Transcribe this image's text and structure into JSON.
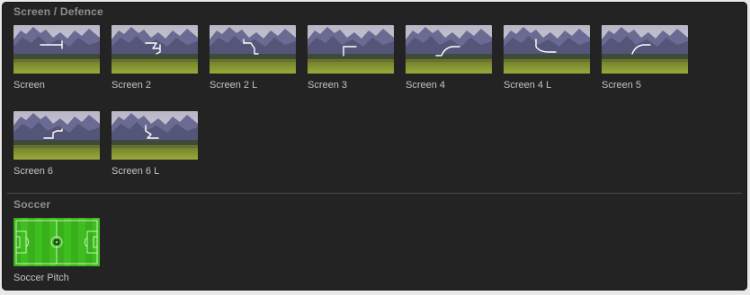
{
  "sections": [
    {
      "title": "Screen / Defence",
      "items": [
        {
          "label": "Screen",
          "icon": "screen-wipe-icon"
        },
        {
          "label": "Screen 2",
          "icon": "screen-2-wipe-icon"
        },
        {
          "label": "Screen 2 L",
          "icon": "screen-2-l-wipe-icon"
        },
        {
          "label": "Screen 3",
          "icon": "screen-3-wipe-icon"
        },
        {
          "label": "Screen 4",
          "icon": "screen-4-wipe-icon"
        },
        {
          "label": "Screen 4 L",
          "icon": "screen-4-l-wipe-icon"
        },
        {
          "label": "Screen 5",
          "icon": "screen-5-wipe-icon"
        },
        {
          "label": "Screen 6",
          "icon": "screen-6-wipe-icon"
        },
        {
          "label": "Screen 6 L",
          "icon": "screen-6-l-wipe-icon"
        }
      ]
    },
    {
      "title": "Soccer",
      "items": [
        {
          "label": "Soccer Pitch",
          "icon": "soccer-pitch-icon"
        }
      ]
    }
  ],
  "colors": {
    "panel_bg": "#232323",
    "header_text": "#8f8f8f",
    "label_text": "#c4c4c4",
    "pitch_green": "#3fbf1f"
  }
}
